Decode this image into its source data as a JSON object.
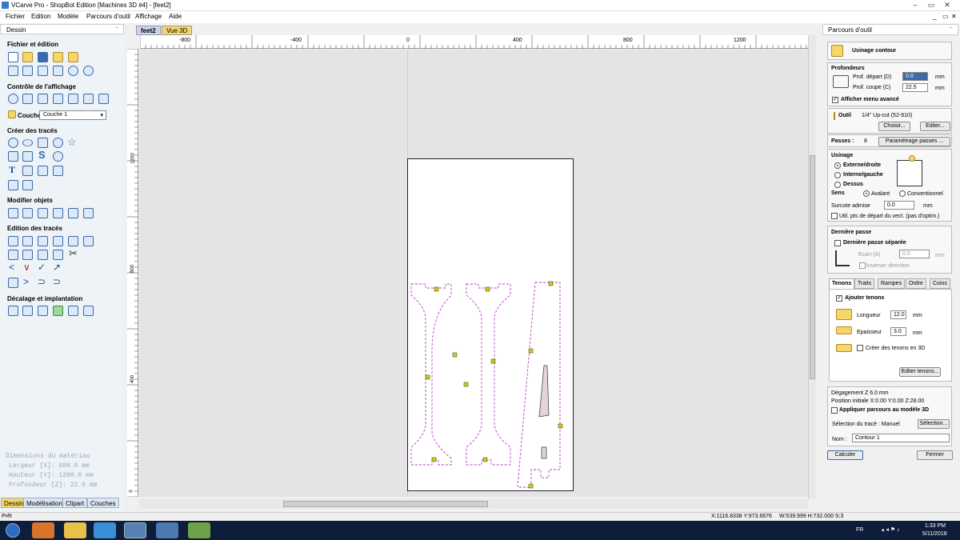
{
  "window": {
    "title": "VCarve Pro - ShopBot Edition [Machines 3D #4] - [feet2]"
  },
  "menu": [
    "Fichier",
    "Edition",
    "Modèle",
    "Parcours d'outil",
    "Affichage",
    "Aide"
  ],
  "left_panel": {
    "title": "Dessin",
    "pin": "`",
    "sections": [
      "Fichier et édition",
      "Contrôle de l'affichage",
      "Créer des tracés",
      "Modifier objets",
      "Edition des tracés",
      "Décalage et implantation"
    ],
    "layer_label": "Couche",
    "layer_value": "Couche 1",
    "material": {
      "title": "Dimensions du matériau",
      "width": "Largeur  [X]: 600.0 mm",
      "height": "Hauteur  [Y]: 1200.0 mm",
      "depth": "Profondeur [Z]: 22.0 mm"
    },
    "tabs": [
      "Dessin",
      "Modélisation",
      "Clipart",
      "Couches"
    ]
  },
  "doc_tabs": [
    "feet2",
    "Vue 3D"
  ],
  "ruler": {
    "top": [
      "-800",
      "-400",
      "0",
      "400",
      "800",
      "1200"
    ],
    "left": [
      "1200",
      "800",
      "400",
      "0"
    ]
  },
  "right_panel": {
    "title": "Parcours d'outil",
    "pin": "`",
    "header": "Usinage contour",
    "depths_title": "Profondeurs",
    "start_depth_label": "Prof. départ (D)",
    "start_depth": "0.0",
    "cut_depth_label": "Prof. coupe (C)",
    "cut_depth": "22.5",
    "unit": "mm",
    "advanced_menu": "Afficher menu avancé",
    "tool_label": "Outil",
    "tool_value": "1/4\" Up-cut (52-910)",
    "choose_btn": "Choisir...",
    "edit_btn": "Editer...",
    "passes_label": "Passes :",
    "passes_value": "8",
    "passes_btn": "Paramétrage passes ...",
    "machining_title": "Usinage",
    "machining_options": [
      "Externe/droite",
      "Interne/gauche",
      "Dessus"
    ],
    "direction_label": "Sens",
    "direction_options": [
      "Avalant",
      "Conventionnel"
    ],
    "allowance_label": "Surcote admise",
    "allowance_value": "0.0",
    "vector_start": "Util. pts de départ du vect. (pas d'optim.)",
    "last_pass_title": "Dernière passe",
    "last_pass_sep": "Dernière passe séparée",
    "gap_label": "Ecart (A)",
    "gap_value": "0.0",
    "reverse_dir": "Inverser direction",
    "tabs": [
      "Tenons",
      "Traits",
      "Rampes",
      "Ordre",
      "Coins"
    ],
    "add_tenons": "Ajouter tenons",
    "length_label": "Longueur",
    "length_value": "12.0",
    "thickness_label": "Epaisseur",
    "thickness_value": "3.0",
    "tenons3d": "Créer des tenons en 3D",
    "edit_tenons": "Editer tenons...",
    "clearance": "Dégagement Z  6.0 mm",
    "home_pos": "Position initiale  X:0.00 Y:0.00 Z:28.00",
    "apply_3d": "Appliquer parcours au modèle 3D",
    "selection_label": "Sélection du tracé : Manuel",
    "selection_btn": "Sélection...",
    "name_label": "Nom :",
    "name_value": "Contour 1",
    "calc_btn": "Calculer",
    "close_btn": "Fermer"
  },
  "status": {
    "left": "Prêt",
    "coords": "X:1116.8338 Y:973.6676",
    "size": "W:539.999  H:732.000  S:3"
  },
  "taskbar": {
    "lang": "FR",
    "time": "1:33 PM",
    "date": "5/11/2018"
  },
  "colors": {
    "toolpath": "#b53fc7",
    "tenon": "#c8d400",
    "accent": "#f6d66a",
    "taskbar": "#0e1d3a"
  }
}
